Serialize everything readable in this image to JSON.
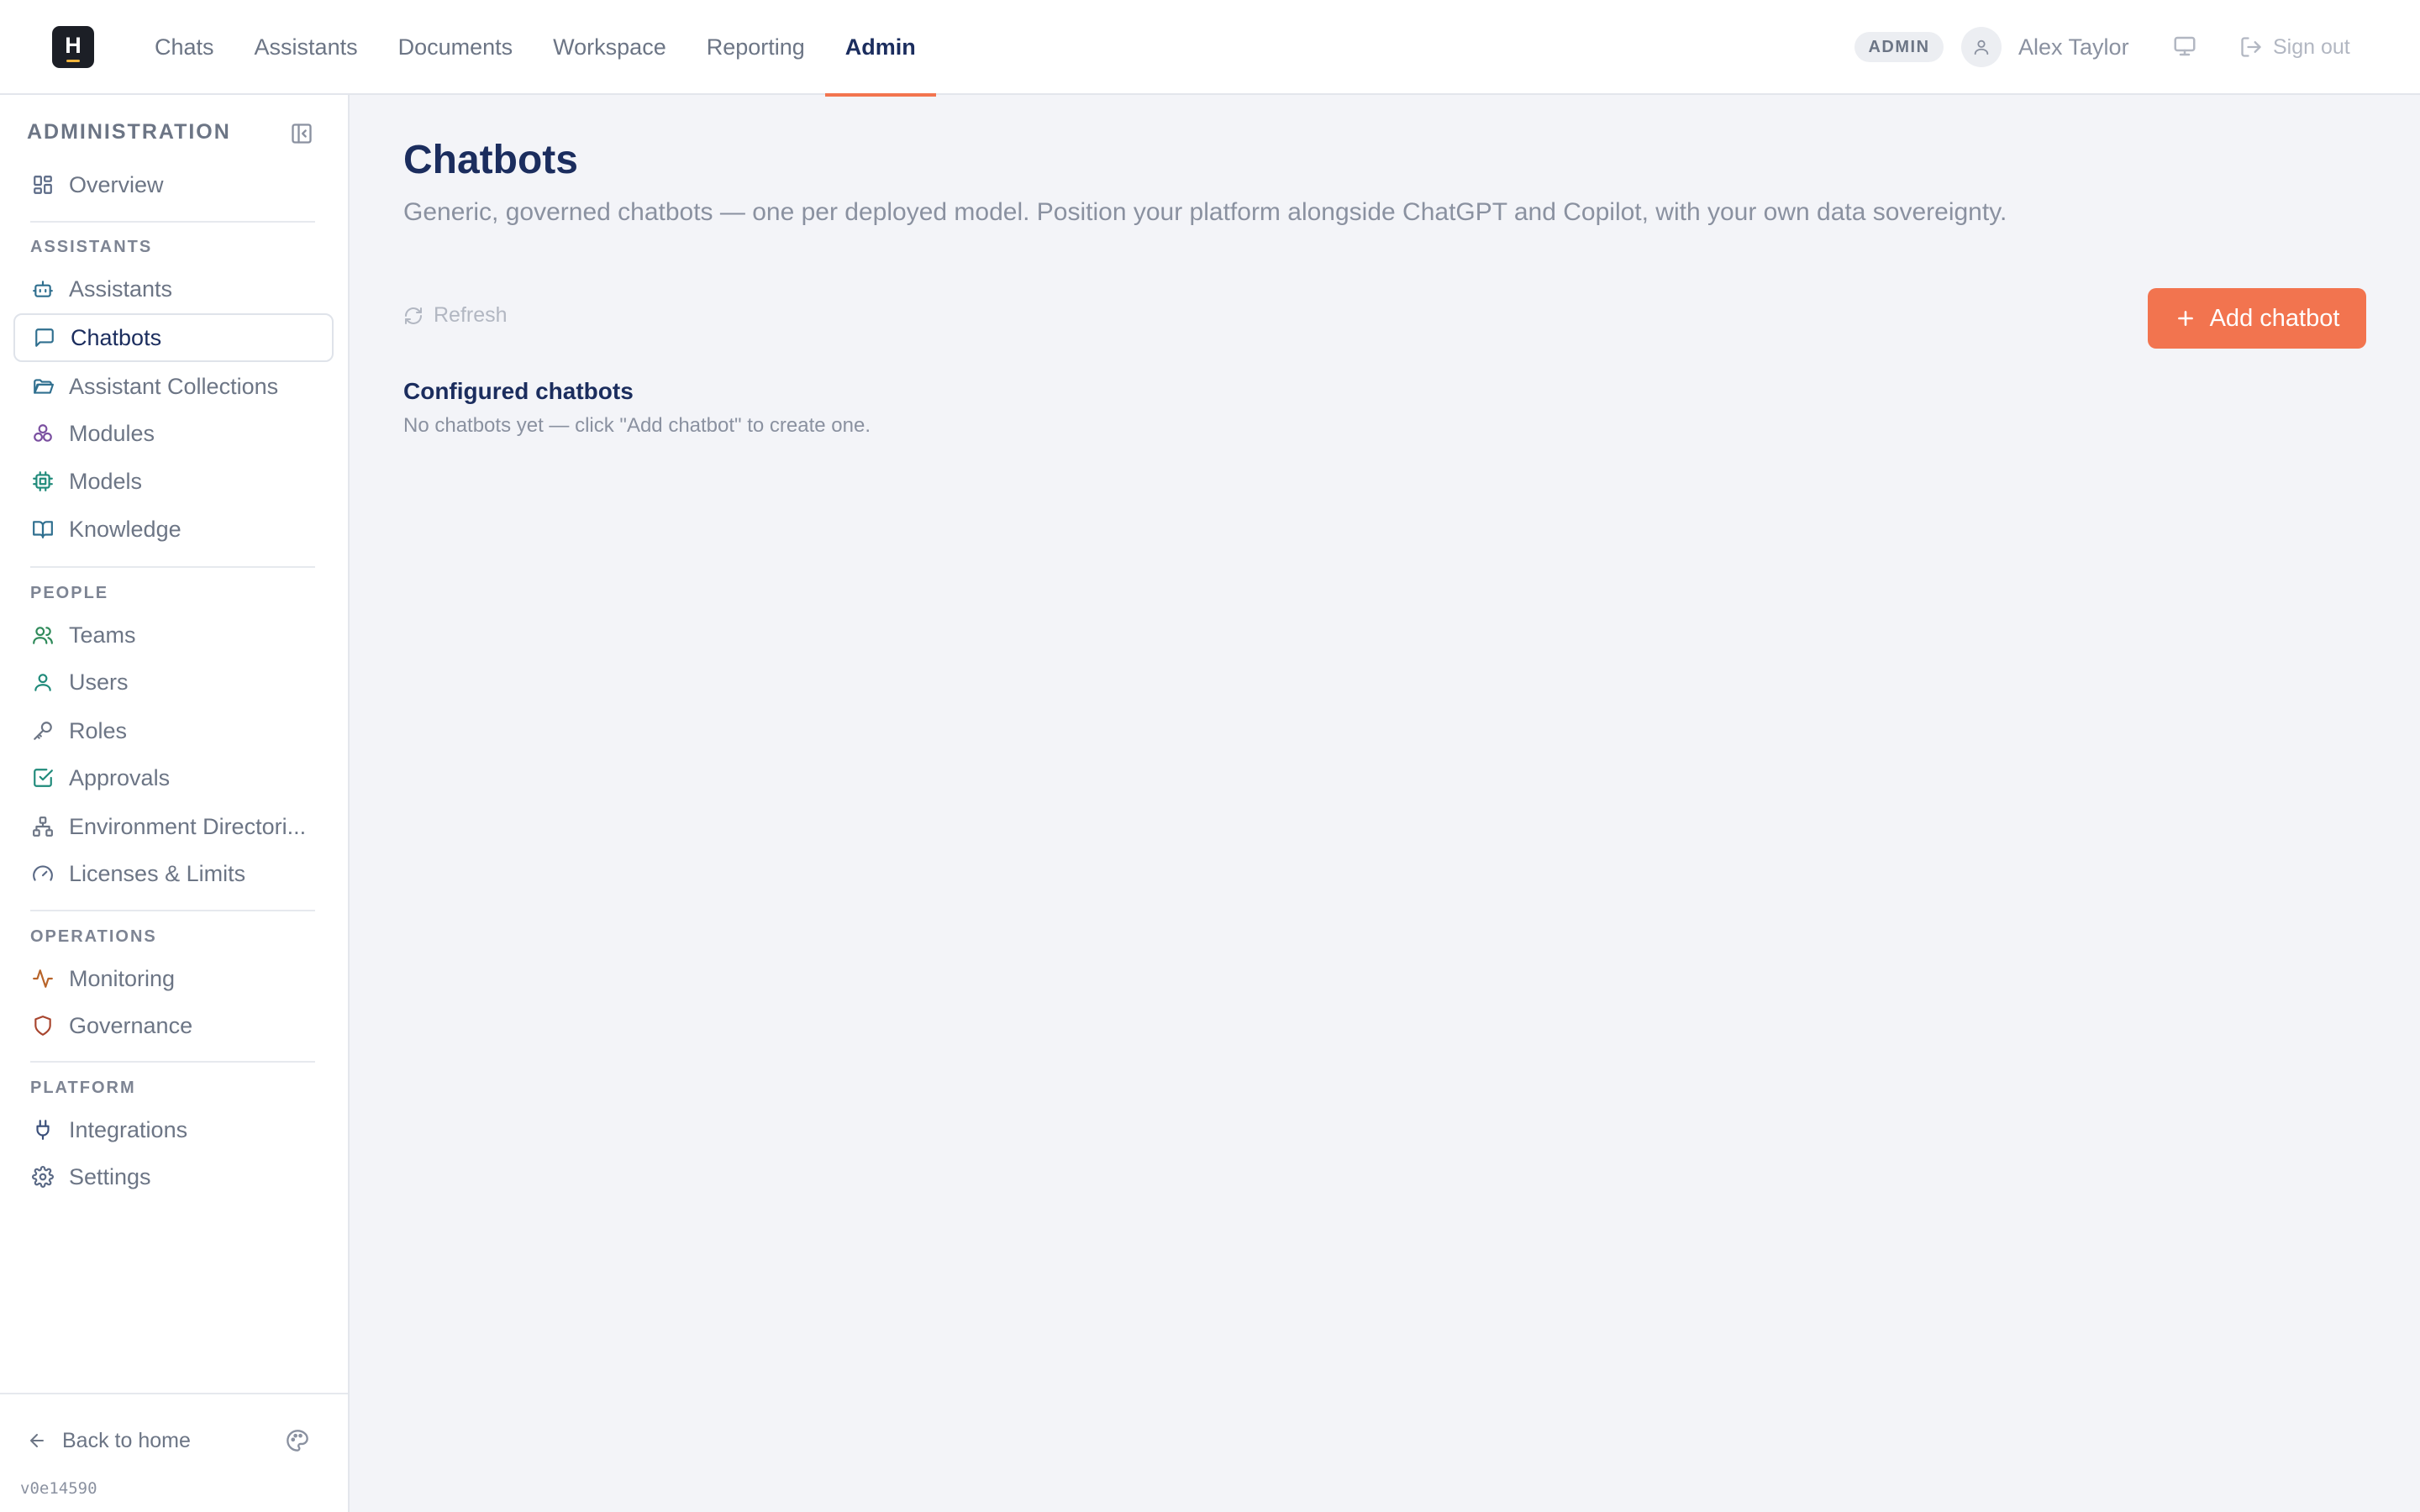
{
  "brand": {
    "logo_letter": "H"
  },
  "nav": {
    "items": [
      {
        "label": "Chats",
        "active": false
      },
      {
        "label": "Assistants",
        "active": false
      },
      {
        "label": "Documents",
        "active": false
      },
      {
        "label": "Workspace",
        "active": false
      },
      {
        "label": "Reporting",
        "active": false
      },
      {
        "label": "Admin",
        "active": true
      }
    ]
  },
  "user": {
    "role_badge": "ADMIN",
    "name": "Alex Taylor",
    "sign_out_label": "Sign out"
  },
  "sidebar": {
    "title": "ADMINISTRATION",
    "overview": {
      "label": "Overview",
      "icon": "grid-icon"
    },
    "sections": {
      "assistants": "ASSISTANTS",
      "people": "PEOPLE",
      "operations": "OPERATIONS",
      "platform": "PLATFORM"
    },
    "items": {
      "assistants": {
        "label": "Assistants",
        "icon": "bot-icon"
      },
      "chatbots": {
        "label": "Chatbots",
        "icon": "message-square-icon",
        "active": true
      },
      "assistant_collections": {
        "label": "Assistant Collections",
        "icon": "folder-open-icon"
      },
      "modules": {
        "label": "Modules",
        "icon": "modules-icon"
      },
      "models": {
        "label": "Models",
        "icon": "cpu-icon"
      },
      "knowledge": {
        "label": "Knowledge",
        "icon": "book-icon"
      },
      "teams": {
        "label": "Teams",
        "icon": "users-icon"
      },
      "users": {
        "label": "Users",
        "icon": "user-icon"
      },
      "roles": {
        "label": "Roles",
        "icon": "key-icon"
      },
      "approvals": {
        "label": "Approvals",
        "icon": "check-square-icon"
      },
      "environment_directories": {
        "label": "Environment Directori...",
        "icon": "network-icon"
      },
      "licenses_limits": {
        "label": "Licenses & Limits",
        "icon": "gauge-icon"
      },
      "monitoring": {
        "label": "Monitoring",
        "icon": "activity-icon"
      },
      "governance": {
        "label": "Governance",
        "icon": "shield-icon"
      },
      "integrations": {
        "label": "Integrations",
        "icon": "plug-icon"
      },
      "settings": {
        "label": "Settings",
        "icon": "gear-icon"
      }
    },
    "back_home_label": "Back to home",
    "version": "v0e14590"
  },
  "main": {
    "title": "Chatbots",
    "subtitle": "Generic, governed chatbots — one per deployed model. Position your platform alongside ChatGPT and Copilot, with your own data sovereignty.",
    "refresh_label": "Refresh",
    "add_button_label": "Add chatbot",
    "configured_heading": "Configured chatbots",
    "empty_message": "No chatbots yet — click \"Add chatbot\" to create one."
  },
  "colors": {
    "accent": "#f2744f",
    "heading": "#1b2d5e",
    "muted": "#6c7585",
    "background": "#f3f4f8"
  }
}
